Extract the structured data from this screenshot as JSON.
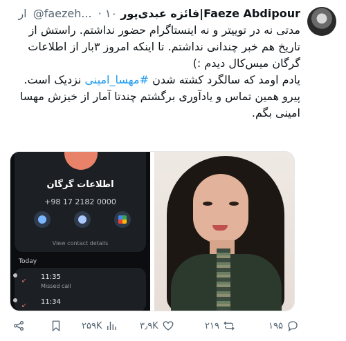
{
  "author": {
    "name": "Faeze Abdipour|فائزه عبدی‌پور",
    "handle": "@faezeh...",
    "time": "۱۰ ار"
  },
  "body": {
    "p1": "مدتی نه در توییتر و نه اینستاگرام حضور نداشتم. راستش از تاریخ هم خبر چندانی نداشتم. تا اینکه امروز ۳بار از اطلاعات گرگان میس‌کال دیدم :)",
    "p2_before": "یادم اومد که سالگرد کشته شدن ",
    "p2_hashtag": "#مهسا_امینی",
    "p2_after": " نزدیک است.",
    "p3": "پیرو همین تماس و یادآوری برگشتم چندتا آمار از خیزش مهسا امینی بگم."
  },
  "media": {
    "phone": {
      "contact_name": "اطلاعات گرگان",
      "contact_number": "+98 17 2182 0000",
      "view_details": "View contact details",
      "section_label": "Today",
      "calls": [
        {
          "time": "11:35",
          "status": "Missed call"
        },
        {
          "time": "11:34",
          "status": ""
        }
      ]
    }
  },
  "actions": {
    "share_icon": "share-icon",
    "bookmark_icon": "bookmark-icon",
    "views": "۲۵۹K",
    "likes": "۳٫۹K",
    "retweets": "۲۱۹",
    "replies": "۱۹۵"
  }
}
